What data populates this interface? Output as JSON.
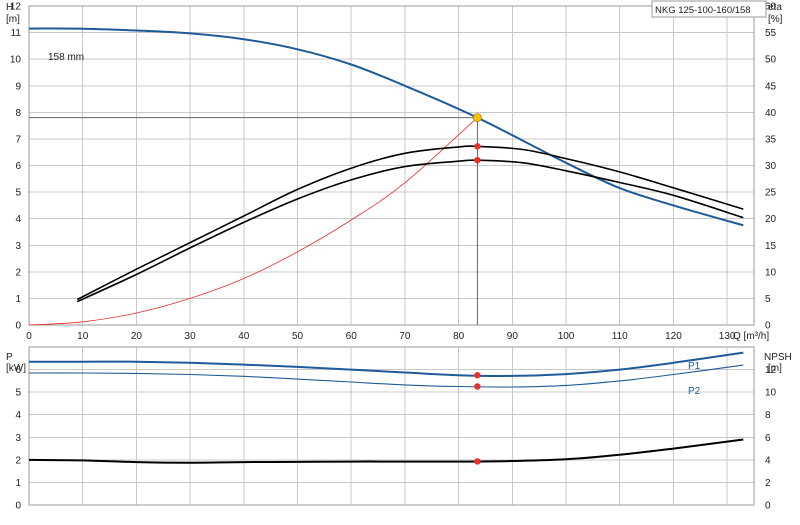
{
  "chart_data": [
    {
      "type": "line",
      "title": "NKG 125-100-160/158",
      "ylabel": "H",
      "ylabel_unit": "[m]",
      "y2label": "eta",
      "y2label_unit": "[%]",
      "xlabel": "Q [m³/h]",
      "xlim": [
        0,
        135
      ],
      "ylim": [
        0,
        12
      ],
      "y2lim": [
        0,
        60
      ],
      "x_ticks": [
        0,
        10,
        20,
        30,
        40,
        50,
        60,
        70,
        80,
        90,
        100,
        110,
        120,
        130
      ],
      "y_ticks": [
        0,
        1,
        2,
        3,
        4,
        5,
        6,
        7,
        8,
        9,
        10,
        11,
        12
      ],
      "y2_ticks": [
        0,
        5,
        10,
        15,
        20,
        25,
        30,
        35,
        40,
        45,
        50,
        55,
        60
      ],
      "grid": true,
      "curve_label": "158 mm",
      "duty_point": {
        "x": 83.5,
        "y": 7.8
      },
      "series": [
        {
          "role": "head",
          "color": "#1f5b99",
          "x": [
            0,
            9,
            20,
            30,
            40,
            50,
            60,
            70,
            83.5,
            100,
            110,
            120,
            133
          ],
          "y": [
            11.15,
            11.15,
            11.08,
            10.97,
            10.75,
            10.37,
            9.8,
            9.0,
            7.8,
            6.1,
            5.15,
            4.5,
            3.75
          ]
        },
        {
          "role": "system",
          "color": "#e8302a",
          "x": [
            0,
            10,
            20,
            30,
            40,
            50,
            60,
            70,
            83.5
          ],
          "y": [
            0,
            0.12,
            0.45,
            1.0,
            1.75,
            2.75,
            3.95,
            5.35,
            7.8
          ]
        },
        {
          "role": "eta",
          "color": "#000000",
          "axis": "y2",
          "x": [
            9,
            20,
            30,
            40,
            50,
            60,
            70,
            80,
            83.5,
            92,
            100,
            110,
            120,
            133
          ],
          "y": [
            4.8,
            10.5,
            15.5,
            20.5,
            25.5,
            29.5,
            32.3,
            33.5,
            33.6,
            33.0,
            31.3,
            28.8,
            25.8,
            21.8
          ]
        },
        {
          "role": "eta",
          "color": "#000000",
          "axis": "y2",
          "x": [
            9,
            20,
            30,
            40,
            50,
            60,
            70,
            80,
            83.5,
            92,
            100,
            110,
            120,
            133
          ],
          "y": [
            4.4,
            9.5,
            14.5,
            19.3,
            23.7,
            27.3,
            29.8,
            30.8,
            31.0,
            30.5,
            29.0,
            26.8,
            24.4,
            20.2
          ]
        }
      ],
      "markers": [
        {
          "x": 83.5,
          "y": 7.8,
          "color": "#f7c300"
        },
        {
          "x": 83.5,
          "y": 6.72,
          "color": "#e8302a"
        },
        {
          "x": 83.5,
          "y": 6.2,
          "color": "#e8302a"
        }
      ]
    },
    {
      "type": "line",
      "ylabel": "P",
      "ylabel_unit": "[kW]",
      "y2label": "NPSH",
      "y2label_unit": "[m]",
      "xlim": [
        0,
        135
      ],
      "ylim": [
        0,
        7
      ],
      "y2lim": [
        0,
        14
      ],
      "y_ticks": [
        0,
        1,
        2,
        3,
        4,
        5,
        6
      ],
      "y2_ticks": [
        0,
        2,
        4,
        6,
        8,
        10,
        12
      ],
      "grid": true,
      "series": [
        {
          "name": "P1",
          "color": "#1f5b99",
          "x": [
            0,
            10,
            20,
            30,
            40,
            50,
            60,
            70,
            80,
            90,
            100,
            110,
            120,
            133
          ],
          "y": [
            6.35,
            6.35,
            6.35,
            6.3,
            6.22,
            6.12,
            6.0,
            5.87,
            5.75,
            5.72,
            5.8,
            6.0,
            6.3,
            6.75
          ]
        },
        {
          "name": "P2",
          "color": "#1f5b99",
          "x": [
            0,
            10,
            20,
            30,
            40,
            50,
            60,
            70,
            80,
            90,
            100,
            110,
            120,
            133
          ],
          "y": [
            5.85,
            5.85,
            5.83,
            5.78,
            5.7,
            5.58,
            5.45,
            5.32,
            5.25,
            5.23,
            5.3,
            5.5,
            5.78,
            6.2
          ]
        },
        {
          "role": "npsh",
          "color": "#000000",
          "axis": "y2",
          "x": [
            0,
            10,
            20,
            30,
            40,
            50,
            60,
            70,
            80,
            90,
            100,
            110,
            120,
            133
          ],
          "y": [
            4.0,
            3.95,
            3.8,
            3.75,
            3.8,
            3.82,
            3.85,
            3.85,
            3.85,
            3.9,
            4.05,
            4.45,
            5.0,
            5.8
          ]
        }
      ],
      "markers": [
        {
          "x": 83.5,
          "y": 5.75,
          "color": "#e8302a"
        },
        {
          "x": 83.5,
          "y": 5.25,
          "color": "#e8302a"
        },
        {
          "x": 83.5,
          "y": 1.93,
          "color": "#e8302a"
        }
      ]
    }
  ]
}
